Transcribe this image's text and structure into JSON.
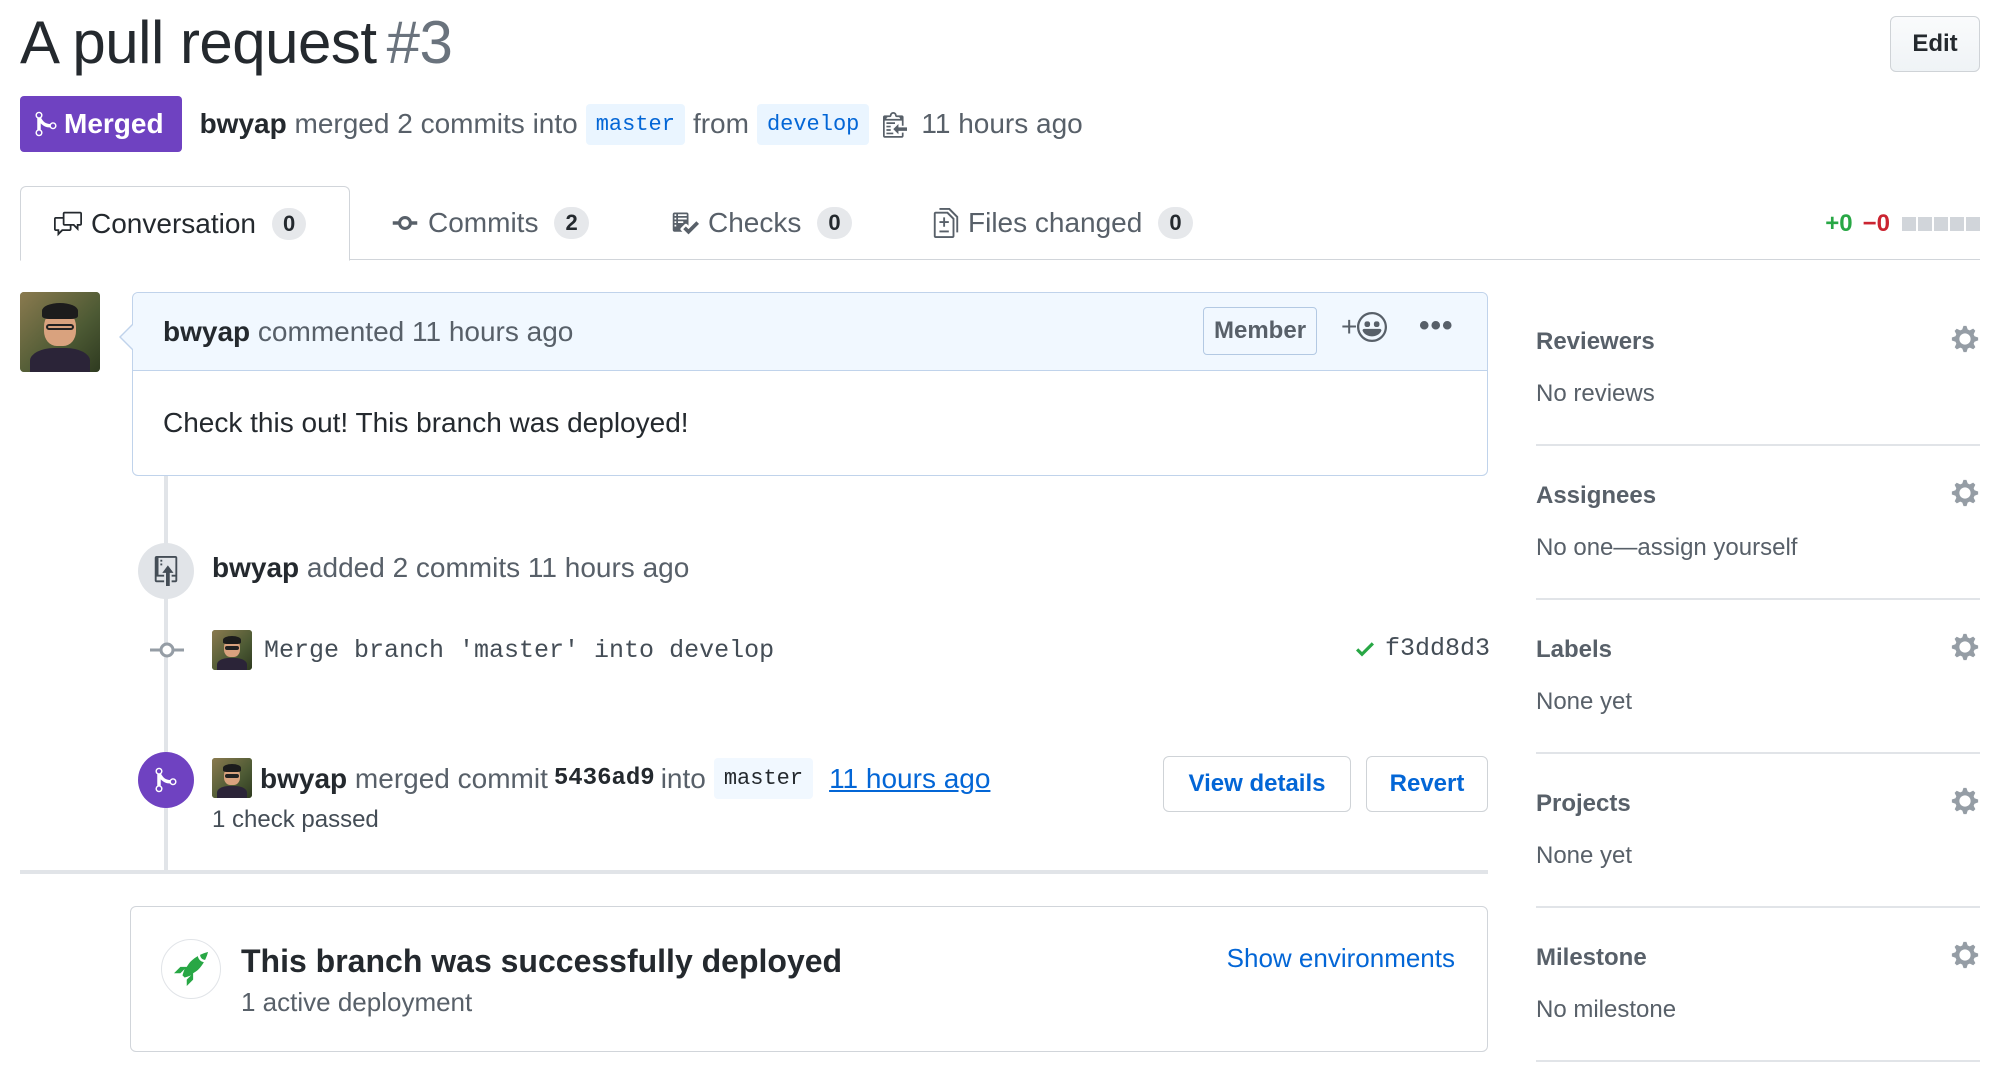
{
  "header": {
    "title": "A pull request",
    "number": "#3",
    "edit_label": "Edit"
  },
  "status": {
    "state_label": "Merged",
    "author": "bwyap",
    "summary": "merged 2 commits into",
    "base_branch": "master",
    "from_word": "from",
    "head_branch": "develop",
    "time": "11 hours ago",
    "colors": {
      "merged": "#6f42c1",
      "link": "#0366d6",
      "addition": "#28a745",
      "deletion": "#cb2431"
    }
  },
  "tabs": [
    {
      "label": "Conversation",
      "count": "0",
      "icon": "comment-discussion-icon"
    },
    {
      "label": "Commits",
      "count": "2",
      "icon": "git-commit-icon"
    },
    {
      "label": "Checks",
      "count": "0",
      "icon": "checklist-icon"
    },
    {
      "label": "Files changed",
      "count": "0",
      "icon": "file-diff-icon"
    }
  ],
  "diffstat": {
    "additions": "+0",
    "deletions": "−0"
  },
  "comment": {
    "author": "bwyap",
    "action": "commented 11 hours ago",
    "role_badge": "Member",
    "reaction_label": "+",
    "more_label": "•••",
    "body": "Check this out! This branch was deployed!"
  },
  "commits_event": {
    "author": "bwyap",
    "text": "added 2 commits 11 hours ago",
    "commit_message": "Merge branch 'master' into develop",
    "commit_sha": "f3dd8d3"
  },
  "merge_event": {
    "author": "bwyap",
    "text": "merged commit",
    "sha": "5436ad9",
    "into_word": "into",
    "branch": "master",
    "time_link": "11 hours ago",
    "check_status": "1 check passed",
    "view_details_label": "View details",
    "revert_label": "Revert"
  },
  "deployment": {
    "title": "This branch was successfully deployed",
    "subtitle": "1 active deployment",
    "show_environments_label": "Show environments"
  },
  "sidebar": [
    {
      "heading": "Reviewers",
      "value": "No reviews"
    },
    {
      "heading": "Assignees",
      "value": "No one—assign yourself"
    },
    {
      "heading": "Labels",
      "value": "None yet"
    },
    {
      "heading": "Projects",
      "value": "None yet"
    },
    {
      "heading": "Milestone",
      "value": "No milestone"
    }
  ]
}
